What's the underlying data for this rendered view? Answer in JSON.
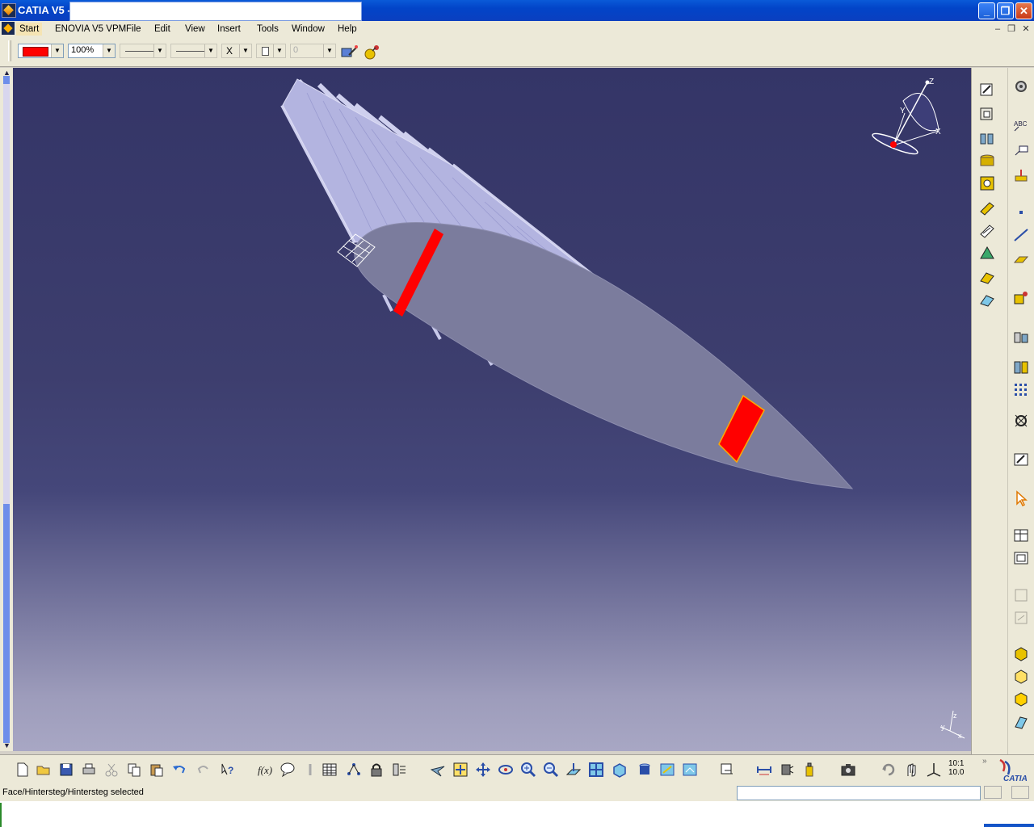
{
  "window": {
    "title": "CATIA V5 -",
    "minimize_glyph": "_",
    "restore_glyph": "❐",
    "close_glyph": "✕"
  },
  "menu": {
    "items": [
      {
        "label": "Start",
        "accel": "S"
      },
      {
        "label": "ENOVIA V5 VPM"
      },
      {
        "label": "File",
        "accel": "F"
      },
      {
        "label": "Edit",
        "accel": "E"
      },
      {
        "label": "View",
        "accel": "V"
      },
      {
        "label": "Insert",
        "accel": "I"
      },
      {
        "label": "Tools",
        "accel": "T"
      },
      {
        "label": "Window",
        "accel": "W"
      },
      {
        "label": "Help",
        "accel": "H"
      }
    ],
    "doc_minimize_glyph": "–",
    "doc_restore_glyph": "❐",
    "doc_close_glyph": "✕"
  },
  "properties": {
    "fill_color": "#ff0000",
    "transparency": "100%",
    "line_type_symbol": "X",
    "layer_value": "0"
  },
  "viewport": {
    "background_top": "#343567",
    "background_bottom": "#a8a7c4",
    "highlight_color": "#ff0000",
    "compass_labels": {
      "z": "Z",
      "x": "X",
      "y": "Y"
    },
    "axis_labels": {
      "z": "z",
      "x": "x",
      "y": "y"
    }
  },
  "status": {
    "message": "Face/Hintersteg/Hintersteg selected"
  },
  "bottom_toolbar": {
    "scale_label_top": "10:1",
    "scale_label_bottom": "10.0"
  },
  "icons": [
    "new-icon",
    "open-icon",
    "save-icon",
    "print-icon",
    "cut-icon",
    "copy-icon",
    "paste-icon",
    "undo-icon",
    "redo-icon",
    "whats-this-icon",
    "formula-icon",
    "comment-icon",
    "design-table-icon",
    "catalog-icon",
    "lock-icon",
    "analysis-icon",
    "fly-mode-icon",
    "fit-all-icon",
    "pan-icon",
    "rotate-icon",
    "zoom-in-icon",
    "zoom-out-icon",
    "normal-view-icon",
    "multi-view-icon",
    "isometric-view-icon",
    "render-style-icon",
    "hide-show-icon",
    "swap-space-icon",
    "measure-icon",
    "inertia-icon",
    "mass-icon",
    "capture-icon",
    "update-icon",
    "compass-icon",
    "axis-icon",
    "scale-icon"
  ],
  "brand": "CATIA"
}
